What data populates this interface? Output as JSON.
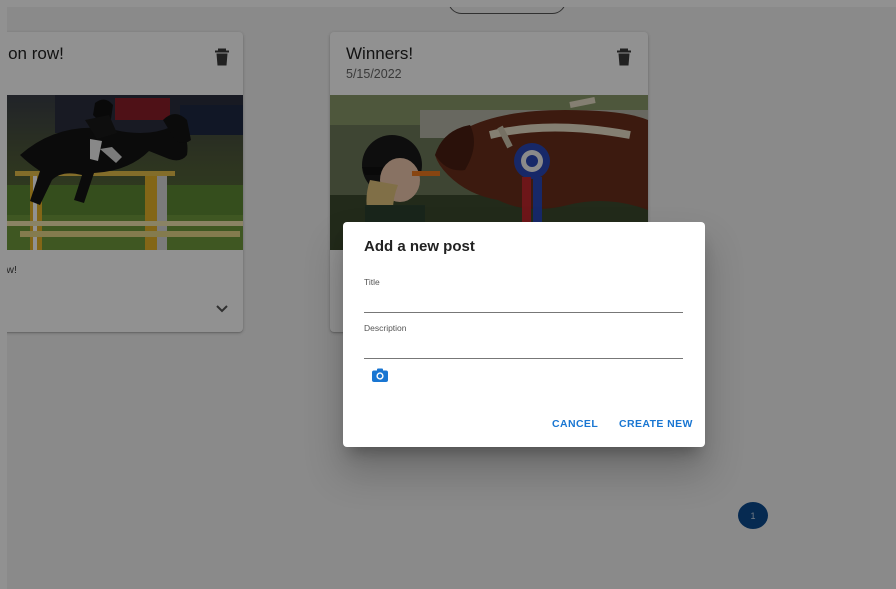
{
  "cards": [
    {
      "title": "Winners on row!",
      "date": "",
      "description": "Winners on row!",
      "image": "horse-jumping-photo",
      "icons": {
        "delete": "trash-icon",
        "expand": "chevron-down-icon"
      }
    },
    {
      "title": "Winners!",
      "date": "5/15/2022",
      "description": "",
      "image": "girl-and-horse-with-ribbon-photo",
      "icons": {
        "delete": "trash-icon"
      }
    }
  ],
  "dialog": {
    "title": "Add a new post",
    "fields": {
      "title_label": "Title",
      "title_value": "",
      "description_label": "Description",
      "description_value": ""
    },
    "camera_icon": "camera-icon",
    "cancel_label": "CANCEL",
    "create_label": "CREATE NEW"
  },
  "pagination": {
    "current_page": "1"
  },
  "colors": {
    "accent": "#1976d2",
    "pagination": "#0b4a8f",
    "backdrop": "#f2f2f2"
  }
}
